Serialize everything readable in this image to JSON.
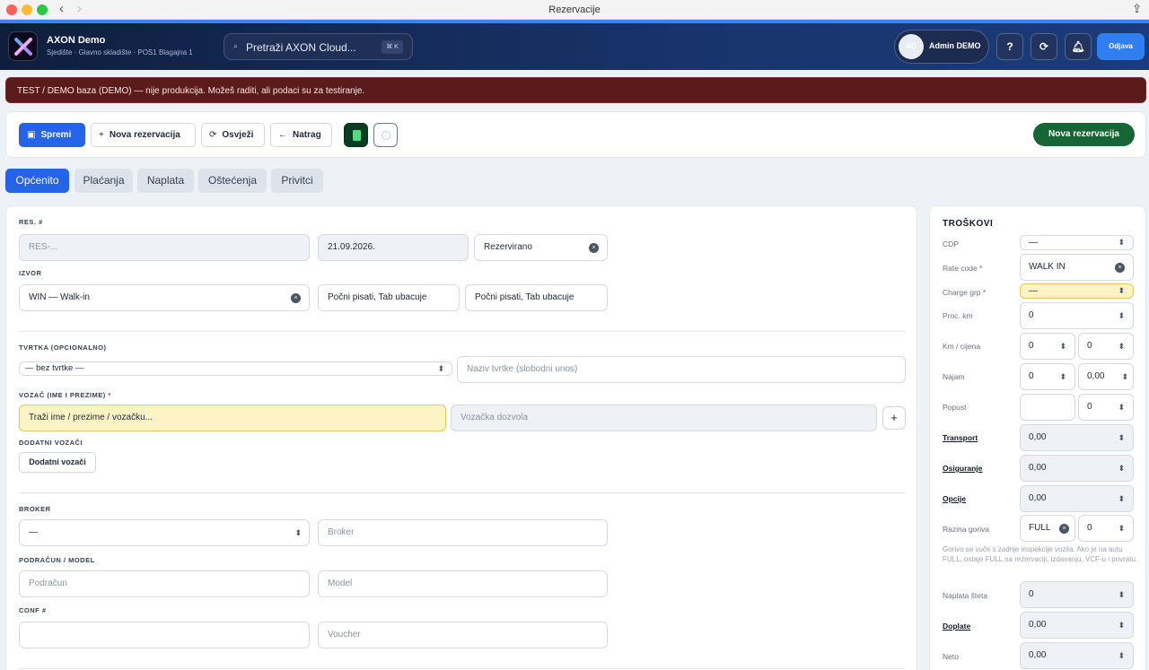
{
  "window": {
    "title": "Rezervacije"
  },
  "header": {
    "brand": "AXON Demo",
    "subtitle": "Sjedište · Glavno skladište · POS1 Blagajna 1",
    "search_placeholder": "Pretraži AXON Cloud...",
    "search_shortcut": "⌘ K",
    "avatar_initials": "AD",
    "user_name": "Admin DEMO",
    "help_label": "?",
    "logout_label": "Odjava"
  },
  "banner": {
    "text": "TEST / DEMO baza (DEMO) — nije produkcija. Možeš raditi, ali podaci su za testiranje."
  },
  "toolbar": {
    "save": "Spremi",
    "new_reservation": "Nova rezervacija",
    "refresh": "Osvježi",
    "back": "Natrag",
    "new_reservation_green": "Nova rezervacija"
  },
  "tabs": [
    "Općenito",
    "Plaćanja",
    "Naplata",
    "Oštećenja",
    "Privitci"
  ],
  "form": {
    "res_label": "RES. #",
    "res_value": "RES-...",
    "date_value": "21.09.2026.",
    "status_value": "Rezervirano",
    "source_label": "IZVOR",
    "source_value": "WIN — Walk-in",
    "typing_hint_1": "Počni pisati, Tab ubacuje",
    "typing_hint_2": "Počni pisati, Tab ubacuje",
    "company_label": "TVRTKA (OPCIONALNO)",
    "company_select": "— bez tvrtke —",
    "company_name_placeholder": "Naziv tvrtke (slobodni unos)",
    "driver_label": "VOZAČ (IME I PREZIME)",
    "driver_required": "*",
    "driver_placeholder": "Traži ime / prezime / vozačku...",
    "license_placeholder": "Vozačka dozvola",
    "add_button": "+",
    "extra_drivers_label": "DODATNI VOZAČI",
    "extra_drivers_button": "Dodatni vozači",
    "broker_label": "BROKER",
    "broker_select": "—",
    "broker_placeholder": "Broker",
    "account_model_label": "PODRAČUN / MODEL",
    "account_placeholder": "Podračun",
    "model_placeholder": "Model",
    "conf_label": "CONF #",
    "conf_value": "",
    "voucher_placeholder": "Voucher"
  },
  "costs": {
    "title": "TROŠKOVI",
    "cdp_label": "CDP",
    "cdp_value": "—",
    "rate_code_label": "Rate code *",
    "rate_code_value": "WALK IN",
    "charge_grp_label": "Charge grp *",
    "charge_grp_value": "—",
    "proc_km_label": "Proc. km",
    "proc_km_value": "0",
    "km_price_label": "Km / cijena",
    "km_value": "0",
    "price_value": "0",
    "rent_label": "Najam",
    "rent_value": "0",
    "rent_amount": "0,00",
    "discount_label": "Popust",
    "discount_value": "",
    "discount_percent": "0",
    "transport_label": "Transport",
    "transport_value": "0,00",
    "insurance_label": "Osiguranje",
    "insurance_value": "0,00",
    "options_label": "Opcije",
    "options_value": "0,00",
    "fuel_label": "Razina goriva",
    "fuel_value": "FULL",
    "fuel_extra": "0",
    "fuel_note": "Gorivo se vuče s zadnje inspekcije vozila. Ako je na autu FULL, ostaje FULL na rezervaciji, izdavanju, VCF-u i povratu.",
    "damage_label": "Naplata šteta",
    "damage_value": "0",
    "surcharges_label": "Doplate",
    "surcharges_value": "0,00",
    "net_label": "Neto",
    "net_value": "0,00"
  }
}
